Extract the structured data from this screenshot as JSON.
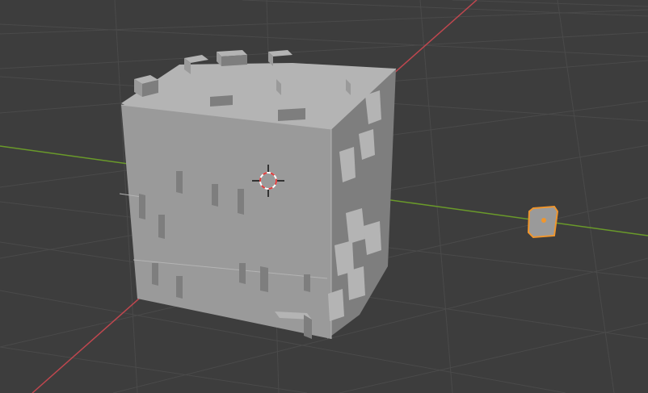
{
  "app": "3D viewport",
  "colors": {
    "background": "#3d3d3d",
    "grid_line": "#4a4a4a",
    "x_axis": "#c0474f",
    "y_axis": "#6a9a2a",
    "mesh_front": "#9a9a9a",
    "mesh_side": "#7e7e7e",
    "mesh_top": "#b4b4b4",
    "selection_outline": "#f0962d",
    "cursor_ring_red": "#e03c3c",
    "cursor_ring_white": "#ffffff"
  },
  "icons": {
    "cursor": "3d-cursor-icon",
    "origin": "object-origin-icon"
  }
}
